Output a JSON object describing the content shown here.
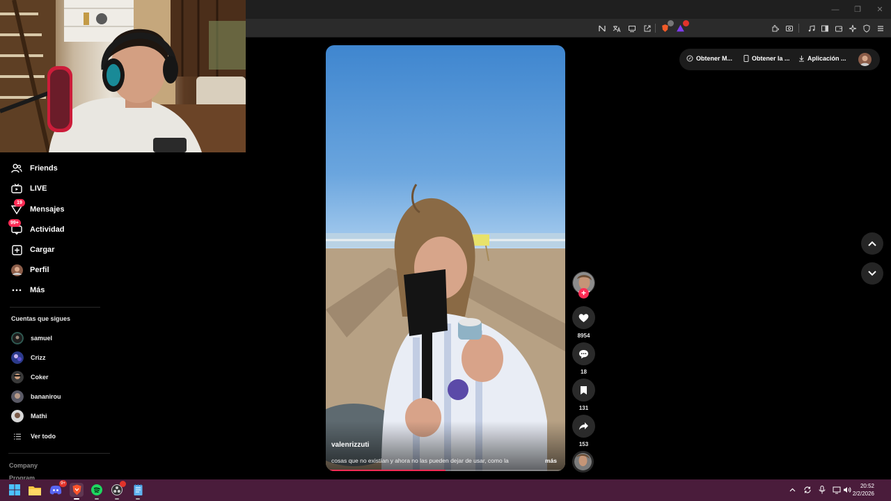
{
  "browser": {
    "window_controls": [
      "—",
      "❐",
      "✕"
    ]
  },
  "nav": {
    "items": [
      {
        "label": "Friends",
        "icon": "friends-icon",
        "badge": ""
      },
      {
        "label": "LIVE",
        "icon": "live-icon",
        "badge": ""
      },
      {
        "label": "Mensajes",
        "icon": "messages-icon",
        "badge": "19"
      },
      {
        "label": "Actividad",
        "icon": "activity-icon",
        "badge": "99+"
      },
      {
        "label": "Cargar",
        "icon": "upload-icon",
        "badge": ""
      },
      {
        "label": "Perfil",
        "icon": "profile-avatar",
        "badge": ""
      },
      {
        "label": "Más",
        "icon": "more-icon",
        "badge": ""
      }
    ]
  },
  "following": {
    "title": "Cuentas que sigues",
    "accounts": [
      "samuel",
      "Crizz",
      "Coker",
      "bananirou",
      "Mathi"
    ],
    "see_all": "Ver todo"
  },
  "footer": {
    "links": [
      "Company",
      "Program"
    ]
  },
  "video": {
    "username": "valenrizzuti",
    "description": "cosas que no existían y ahora no las pueden dejar de usar, como la",
    "more": "más",
    "progress": 0.5
  },
  "actions": {
    "likes": "8954",
    "comments": "18",
    "saves": "131",
    "shares": "153"
  },
  "top_bar": {
    "get_coins": "Obtener M...",
    "get_app": "Obtener la ...",
    "desktop_app": "Aplicación ..."
  },
  "taskbar": {
    "time": "20:52",
    "date": "2/2/2026",
    "discord_badge": "9+"
  },
  "colors": {
    "accent": "#fe2c55",
    "taskbar": "#4a1c3b"
  }
}
